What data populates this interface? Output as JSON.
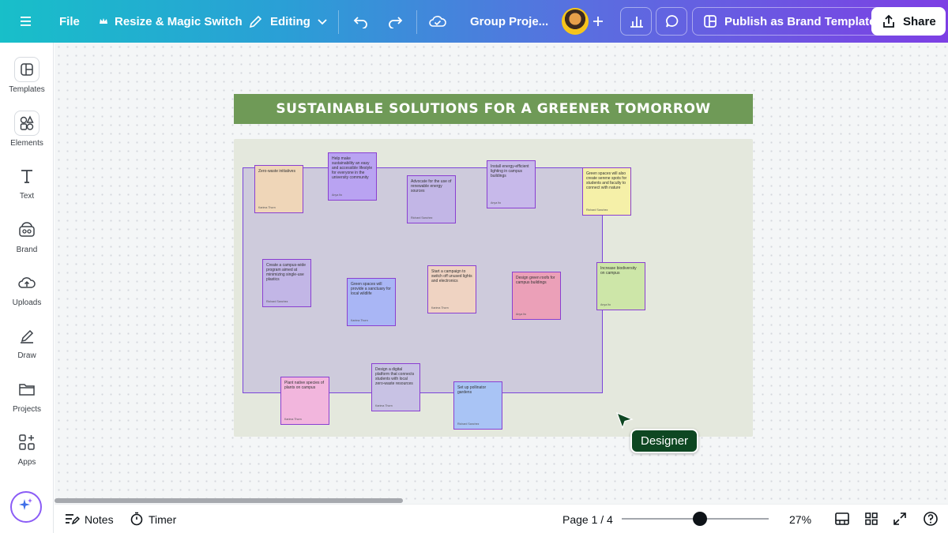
{
  "topbar": {
    "file_label": "File",
    "resize_label": "Resize & Magic Switch",
    "editing_label": "Editing",
    "doc_title": "Group Proje...",
    "publish_label": "Publish as Brand Template",
    "share_label": "Share",
    "icons": [
      "menu-icon",
      "crown-icon",
      "pencil-icon",
      "chevron-down-icon",
      "undo-icon",
      "redo-icon",
      "cloud-check-icon",
      "plus-icon",
      "bar-chart-icon",
      "comment-icon",
      "template-icon",
      "share-upload-icon"
    ]
  },
  "sidebar": {
    "items": [
      {
        "label": "Templates",
        "icon": "templates-icon"
      },
      {
        "label": "Elements",
        "icon": "elements-icon"
      },
      {
        "label": "Text",
        "icon": "text-icon"
      },
      {
        "label": "Brand",
        "icon": "brand-icon"
      },
      {
        "label": "Uploads",
        "icon": "upload-cloud-icon"
      },
      {
        "label": "Draw",
        "icon": "draw-icon"
      },
      {
        "label": "Projects",
        "icon": "folder-icon"
      },
      {
        "label": "Apps",
        "icon": "apps-icon"
      }
    ],
    "magic_icon": "sparkle-icon"
  },
  "canvas": {
    "title": "SUSTAINABLE SOLUTIONS FOR A GREENER TOMORROW",
    "title_color": "#6f9a57",
    "board_color": "#e4e8dd",
    "notes": [
      {
        "text": "Zero-waste initiatives",
        "author": "Karima Thorn",
        "color": "#efd6b8"
      },
      {
        "text": "Help make sustainability an easy and accessible lifestyle for everyone in the university community",
        "author": "Anya Ito",
        "color": "#b9a3f2"
      },
      {
        "text": "Advocate for the use of renewable energy sources",
        "author": "Richard Sanchez",
        "color": "#c2b6e6"
      },
      {
        "text": "Install energy-efficient lighting in campus buildings",
        "author": "Anya Ito",
        "color": "#c7b9ea"
      },
      {
        "text": "Green spaces will also create serene spots for students and faculty to connect with nature",
        "author": "Richard Sanchez",
        "color": "#f5f0a8"
      },
      {
        "text": "Create a campus-wide program aimed at minimizing single-use plastics",
        "author": "Richard Sanchez",
        "color": "#c2b6e6"
      },
      {
        "text": "Green spaces will provide a sanctuary for local wildlife",
        "author": "Karima Thorn",
        "color": "#a9b6f5"
      },
      {
        "text": "Start a campaign to switch off unused lights and electronics",
        "author": "Karima Thorn",
        "color": "#efd3c2"
      },
      {
        "text": "Design green roofs for campus buildings",
        "author": "Anya Ito",
        "color": "#eba0b8"
      },
      {
        "text": "Increase biodiversity on campus",
        "author": "Anya Ito",
        "color": "#cde6a8"
      },
      {
        "text": "Plant native species of plants on campus",
        "author": "Karima Thorn",
        "color": "#f2b6dd"
      },
      {
        "text": "Design a digital platform that connects students with local zero-waste resources",
        "author": "Karima Thorn",
        "color": "#c8c2e4"
      },
      {
        "text": "Set up pollinator gardens",
        "author": "Richard Sanchez",
        "color": "#a9c4f5"
      }
    ],
    "collaborator_label": "Designer"
  },
  "bottombar": {
    "notes_label": "Notes",
    "timer_label": "Timer",
    "page_label": "Page 1 / 4",
    "zoom_percent": 27,
    "zoom_label": "27%"
  }
}
